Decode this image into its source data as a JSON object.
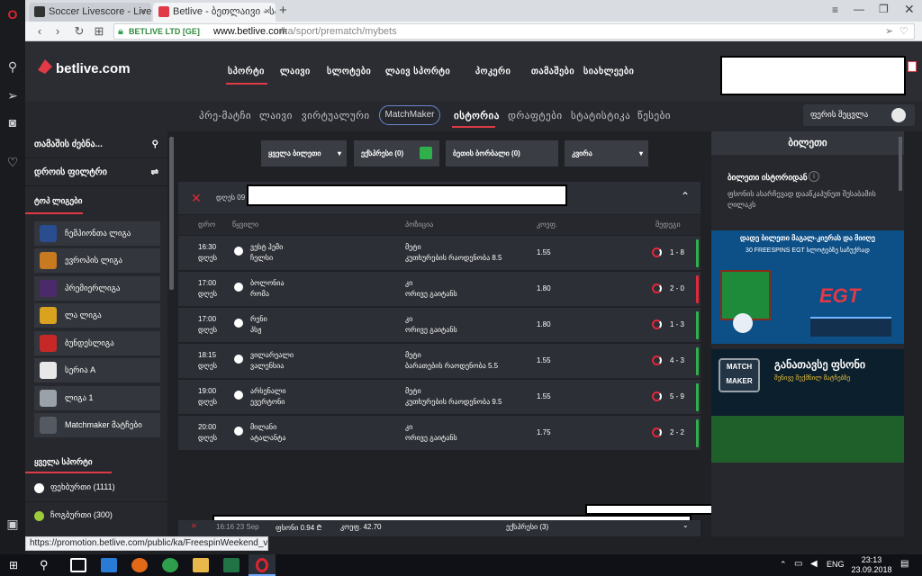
{
  "browser": {
    "tabs": [
      {
        "title": "Soccer Livescore - Live Sc",
        "active": false
      },
      {
        "title": "Betlive - ბეთლაივი - სპ",
        "active": true
      }
    ],
    "new_tab": "+",
    "secure_label": "BETLIVE LTD [GE]",
    "url_host": "www.betlive.com",
    "url_path": "/ka/sport/prematch/mybets",
    "status_url": "https://promotion.betlive.com/public/ka/FreespinWeekend_v2/"
  },
  "site": {
    "logo_text": "betlive.com",
    "main_nav": [
      "სპორტი",
      "ლაივი",
      "სლოტები",
      "ლაივ სპორტი",
      "პოკერი",
      "თამაშები",
      "სიახლეები"
    ],
    "sub_nav": [
      "პრე-მატჩი",
      "ლაივი",
      "ვირტუალური",
      "MatchMaker",
      "ისტორია",
      "დრაფტები",
      "სტატისტიკა",
      "წესები"
    ],
    "color_scheme_label": "ფერის შეცვლა",
    "left": {
      "search_label": "თამაშის ძებნა...",
      "time_filter_label": "დროის ფილტრი",
      "top_leagues_label": "ტოპ ლიგები",
      "leagues": [
        "ჩემპიონთა ლიგა",
        "ევროპის ლიგა",
        "პრემიერლიგა",
        "ლა ლიგა",
        "ბუნდესლიგა",
        "სერია A",
        "ლიგა 1",
        "Matchmaker მატჩები"
      ],
      "all_sports_label": "ყველა სპორტი",
      "sports": [
        {
          "name": "ფეხბურთი (1111)"
        },
        {
          "name": "ჩოგბურთი (300)"
        }
      ]
    },
    "center": {
      "filters": [
        "ყველა ბილეთი",
        "ექსპრესი (0)",
        "ბეთის ბორბალი (0)",
        "კვირა"
      ],
      "bet_header_prefix": "დღეს 09",
      "columns": [
        "დრო",
        "წყვილი",
        "პოზიცია",
        "კოეფ.",
        "შედეგი"
      ],
      "rows": [
        {
          "time": "16:30",
          "day": "დღეს",
          "team1": "ვესტ ჰემი",
          "team2": "ჩელსი",
          "pos1": "მეტი",
          "pos2": "კუთხურების რაოდენობა 8.5",
          "odds": "1.55",
          "score": "1 - 8",
          "status": "win"
        },
        {
          "time": "17:00",
          "day": "დღეს",
          "team1": "ბოლონია",
          "team2": "რომა",
          "pos1": "კი",
          "pos2": "ორივე გაიტანს",
          "odds": "1.80",
          "score": "2 - 0",
          "status": "lose"
        },
        {
          "time": "17:00",
          "day": "დღეს",
          "team1": "რენი",
          "team2": "პსჟ",
          "pos1": "კი",
          "pos2": "ორივე გაიტანს",
          "odds": "1.80",
          "score": "1 - 3",
          "status": "win"
        },
        {
          "time": "18:15",
          "day": "დღეს",
          "team1": "ვილარეალი",
          "team2": "ვალენსია",
          "pos1": "მეტი",
          "pos2": "ბარათების რაოდენობა 5.5",
          "odds": "1.55",
          "score": "4 - 3",
          "status": "win"
        },
        {
          "time": "19:00",
          "day": "დღეს",
          "team1": "არსენალი",
          "team2": "ევერტონი",
          "pos1": "მეტი",
          "pos2": "კუთხურების რაოდენობა 9.5",
          "odds": "1.55",
          "score": "5 - 9",
          "status": "win"
        },
        {
          "time": "20:00",
          "day": "დღეს",
          "team1": "მილანი",
          "team2": "ატალანტა",
          "pos1": "კი",
          "pos2": "ორივე გაიტანს",
          "odds": "1.75",
          "score": "2 - 2",
          "status": "win"
        }
      ],
      "bottom": {
        "time": "16:16 23 Sep",
        "stake": "ფსონი 0.94 ₾",
        "odds": "კოეფ. 42.70",
        "type": "ექსპრესი (3)"
      }
    },
    "right": {
      "title": "ბილეთი",
      "ticket_history": "ბილეთი ისტორიდან",
      "info": "ფსონის ასარჩევად დააწკაპუნეთ შესაბამის ღილაკს",
      "banner1_top": "დადე ბილეთი მაგალ-კიერას და მიიღე",
      "banner1_sub": "30 FREESPINS EGT სლოტებზე საჩუქრად",
      "banner1_brand": "EGT",
      "banner2_logo": "MATCH MAKER",
      "banner2_title": "განათავსე ფსონი",
      "banner2_sub": "შენივე შექმნილ მატჩებზე"
    }
  },
  "taskbar": {
    "lang": "ENG",
    "time": "23:13",
    "date": "23.09.2018"
  },
  "colors": {
    "accent_red": "#e03a46",
    "win_green": "#2fb04a",
    "lose_red": "#e0293a",
    "bg": "#1f2125"
  }
}
